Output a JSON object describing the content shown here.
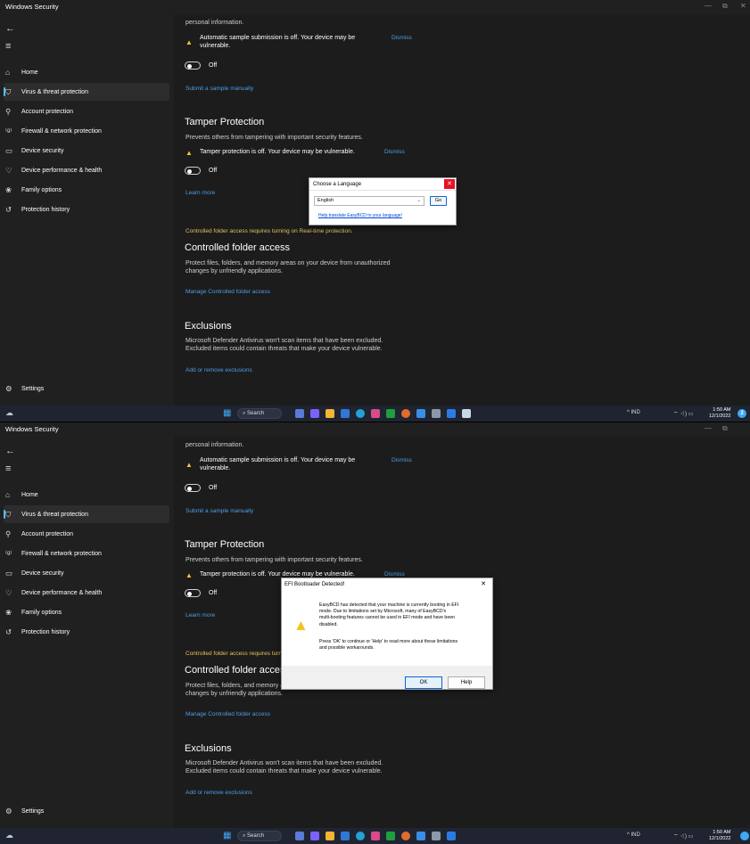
{
  "app": {
    "title": "Windows Security",
    "minimize": "—",
    "restore": "⧉",
    "close": "✕"
  },
  "sidebar": {
    "back_glyph": "←",
    "menu_glyph": "≡",
    "items": [
      {
        "label": "Home",
        "icon": "home-icon",
        "glyph": "⌂"
      },
      {
        "label": "Virus & threat protection",
        "icon": "shield-icon",
        "glyph": "⛉"
      },
      {
        "label": "Account protection",
        "icon": "person-icon",
        "glyph": "⚲"
      },
      {
        "label": "Firewall & network protection",
        "icon": "wifi-icon",
        "glyph": "⁽ᵍ⁾"
      },
      {
        "label": "Device security",
        "icon": "laptop-icon",
        "glyph": "▭"
      },
      {
        "label": "Device performance & health",
        "icon": "heart-icon",
        "glyph": "♡"
      },
      {
        "label": "Family options",
        "icon": "family-icon",
        "glyph": "❀"
      },
      {
        "label": "Protection history",
        "icon": "history-icon",
        "glyph": "↺"
      }
    ],
    "settings": {
      "label": "Settings",
      "icon": "gear-icon",
      "glyph": "⚙"
    }
  },
  "content": {
    "personal_info": "personal information.",
    "sample_warning_line1": "Automatic sample submission is off. Your device may be",
    "sample_warning_line2": "vulnerable.",
    "dismiss": "Dismiss",
    "toggle_off": "Off",
    "submit_sample": "Submit a sample manually",
    "tamper_title": "Tamper Protection",
    "tamper_desc": "Prevents others from tampering with important security features.",
    "tamper_warning": "Tamper protection is off. Your device may be vulnerable.",
    "learn_more": "Learn more",
    "cfa_notice": "Controlled folder access requires turning on Real-time protection.",
    "cfa_title": "Controlled folder access",
    "cfa_desc_line1": "Protect files, folders, and memory areas on your device from unauthorized",
    "cfa_desc_line2": "changes by unfriendly applications.",
    "cfa_manage": "Manage Controlled folder access",
    "exclusions_title": "Exclusions",
    "exclusions_desc_line1": "Microsoft Defender Antivirus won't scan items that have been excluded.",
    "exclusions_desc_line2": "Excluded items could contain threats that make your device vulnerable.",
    "exclusions_link": "Add or remove exclusions"
  },
  "language_dialog": {
    "title": "Choose a Language",
    "selected": "English",
    "go": "Go",
    "help_link": "Help translate EasyBCD to your language!"
  },
  "efi_dialog": {
    "title": "EFI Bootloader Detected!",
    "message_lines": [
      "EasyBCD has detected that your machine is currently booting in EFI",
      "mode. Due to limitations set by Microsoft, many of EasyBCD's",
      "multi-booting features cannot be used in EFI mode and have been",
      "disabled.",
      "Press 'OK' to continue or 'Help' to read more about these limitations",
      "and possible workarounds."
    ],
    "ok": "OK",
    "help": "Help"
  },
  "taskbar": {
    "search": "Search",
    "tray": "^   IND",
    "time": "1:50 AM",
    "date": "12/1/2022",
    "badge": "2"
  },
  "colors": {
    "background": "#1c1c1c",
    "sidebar": "#202020",
    "accent": "#4cc2ff",
    "link": "#4c9ee8",
    "warning": "#f0c23a",
    "notice": "#e4c25a",
    "taskbar": "#1f2430"
  }
}
